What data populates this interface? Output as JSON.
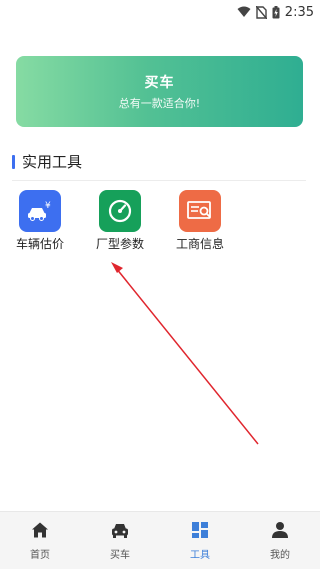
{
  "status_bar": {
    "time": "2:35",
    "icons": [
      "wifi-icon",
      "no-sim-icon",
      "battery-charging-icon"
    ]
  },
  "banner": {
    "title": "买车",
    "subtitle": "总有一款适合你!"
  },
  "section": {
    "title": "实用工具"
  },
  "tools": [
    {
      "label": "车辆估价",
      "icon": "car-valuation-icon",
      "color": "#3d6ff0"
    },
    {
      "label": "厂型参数",
      "icon": "gauge-icon",
      "color": "#16a05a"
    },
    {
      "label": "工商信息",
      "icon": "business-info-icon",
      "color": "#ee6b45"
    }
  ],
  "tabbar": {
    "items": [
      {
        "label": "首页",
        "icon": "home-icon",
        "active": false
      },
      {
        "label": "买车",
        "icon": "car-icon",
        "active": false
      },
      {
        "label": "工具",
        "icon": "tools-grid-icon",
        "active": true
      },
      {
        "label": "我的",
        "icon": "user-icon",
        "active": false
      }
    ]
  },
  "colors": {
    "accent": "#3d6ff0",
    "banner_start": "#86dba3",
    "banner_end": "#2fae92",
    "annotation_arrow": "#e0262e",
    "tab_active": "#3d7fd9"
  }
}
